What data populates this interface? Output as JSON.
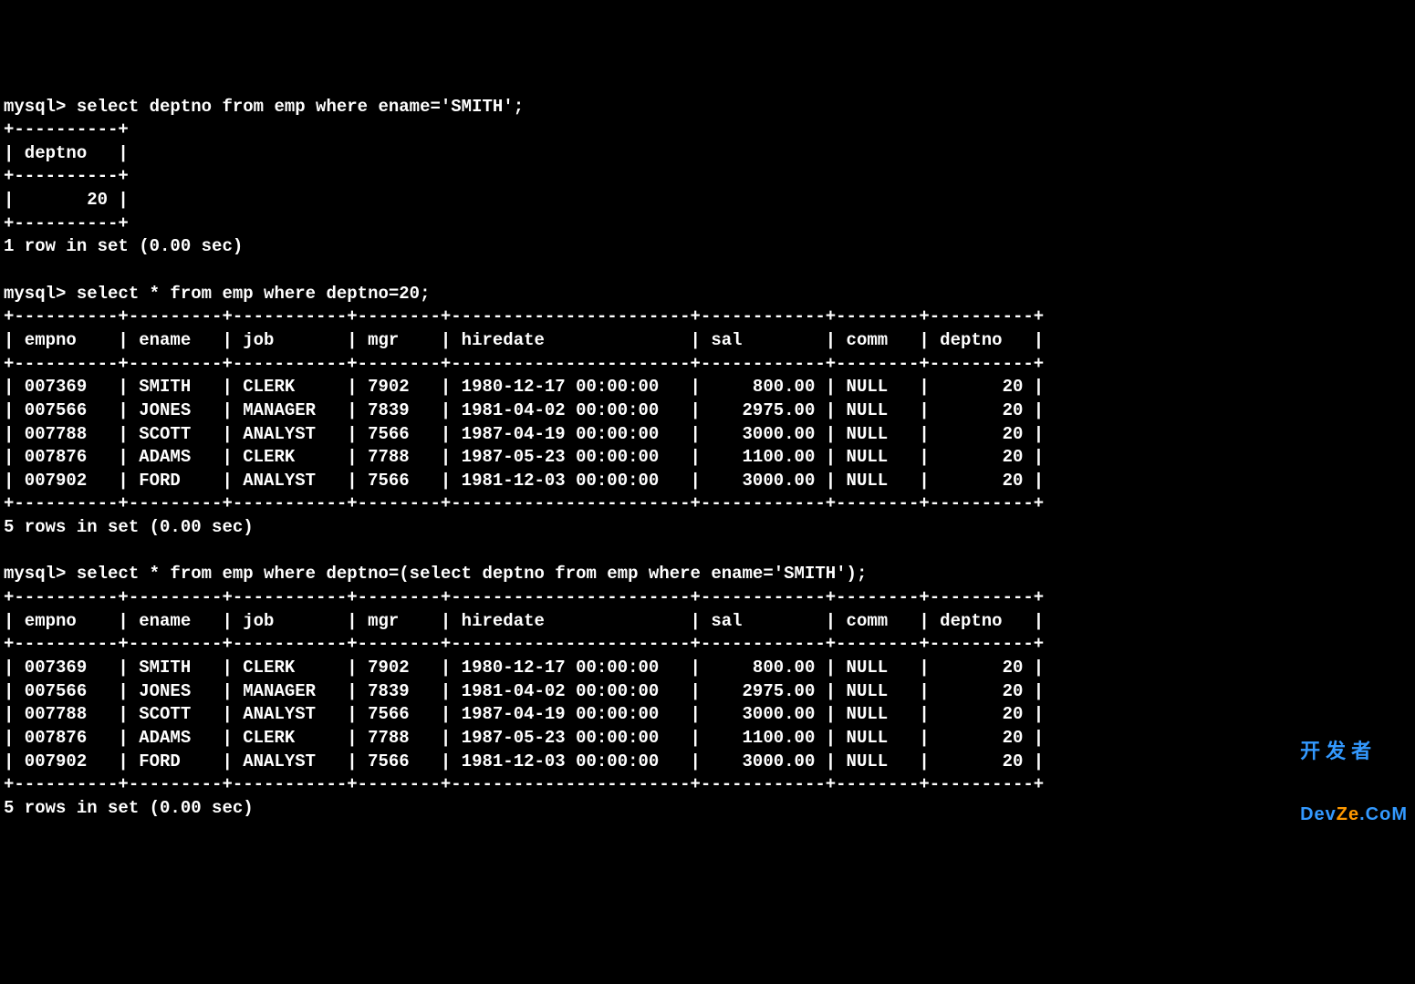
{
  "prompt": "mysql>",
  "queries": {
    "q1": {
      "sql": "select deptno from emp where ename='SMITH';",
      "columns": [
        "deptno"
      ],
      "rows": [
        {
          "deptno": "20"
        }
      ],
      "status": "1 row in set (0.00 sec)"
    },
    "q2": {
      "sql": "select * from emp where deptno=20;",
      "columns": [
        "empno",
        "ename",
        "job",
        "mgr",
        "hiredate",
        "sal",
        "comm",
        "deptno"
      ],
      "rows": [
        {
          "empno": "007369",
          "ename": "SMITH",
          "job": "CLERK",
          "mgr": "7902",
          "hiredate": "1980-12-17 00:00:00",
          "sal": "800.00",
          "comm": "NULL",
          "deptno": "20"
        },
        {
          "empno": "007566",
          "ename": "JONES",
          "job": "MANAGER",
          "mgr": "7839",
          "hiredate": "1981-04-02 00:00:00",
          "sal": "2975.00",
          "comm": "NULL",
          "deptno": "20"
        },
        {
          "empno": "007788",
          "ename": "SCOTT",
          "job": "ANALYST",
          "mgr": "7566",
          "hiredate": "1987-04-19 00:00:00",
          "sal": "3000.00",
          "comm": "NULL",
          "deptno": "20"
        },
        {
          "empno": "007876",
          "ename": "ADAMS",
          "job": "CLERK",
          "mgr": "7788",
          "hiredate": "1987-05-23 00:00:00",
          "sal": "1100.00",
          "comm": "NULL",
          "deptno": "20"
        },
        {
          "empno": "007902",
          "ename": "FORD",
          "job": "ANALYST",
          "mgr": "7566",
          "hiredate": "1981-12-03 00:00:00",
          "sal": "3000.00",
          "comm": "NULL",
          "deptno": "20"
        }
      ],
      "status": "5 rows in set (0.00 sec)"
    },
    "q3": {
      "sql": "select * from emp where deptno=(select deptno from emp where ename='SMITH');",
      "columns": [
        "empno",
        "ename",
        "job",
        "mgr",
        "hiredate",
        "sal",
        "comm",
        "deptno"
      ],
      "rows": [
        {
          "empno": "007369",
          "ename": "SMITH",
          "job": "CLERK",
          "mgr": "7902",
          "hiredate": "1980-12-17 00:00:00",
          "sal": "800.00",
          "comm": "NULL",
          "deptno": "20"
        },
        {
          "empno": "007566",
          "ename": "JONES",
          "job": "MANAGER",
          "mgr": "7839",
          "hiredate": "1981-04-02 00:00:00",
          "sal": "2975.00",
          "comm": "NULL",
          "deptno": "20"
        },
        {
          "empno": "007788",
          "ename": "SCOTT",
          "job": "ANALYST",
          "mgr": "7566",
          "hiredate": "1987-04-19 00:00:00",
          "sal": "3000.00",
          "comm": "NULL",
          "deptno": "20"
        },
        {
          "empno": "007876",
          "ename": "ADAMS",
          "job": "CLERK",
          "mgr": "7788",
          "hiredate": "1987-05-23 00:00:00",
          "sal": "1100.00",
          "comm": "NULL",
          "deptno": "20"
        },
        {
          "empno": "007902",
          "ename": "FORD",
          "job": "ANALYST",
          "mgr": "7566",
          "hiredate": "1981-12-03 00:00:00",
          "sal": "3000.00",
          "comm": "NULL",
          "deptno": "20"
        }
      ],
      "status": "5 rows in set (0.00 sec)"
    }
  },
  "watermark": {
    "line1": "开发者",
    "line2_a": "Dev",
    "line2_b": "Ze",
    "line2_c": ".CoM"
  },
  "column_widths": {
    "small": {
      "deptno": 8
    },
    "full": {
      "empno": 8,
      "ename": 7,
      "job": 9,
      "mgr": 6,
      "hiredate": 21,
      "sal": 10,
      "comm": 6,
      "deptno": 8
    }
  }
}
